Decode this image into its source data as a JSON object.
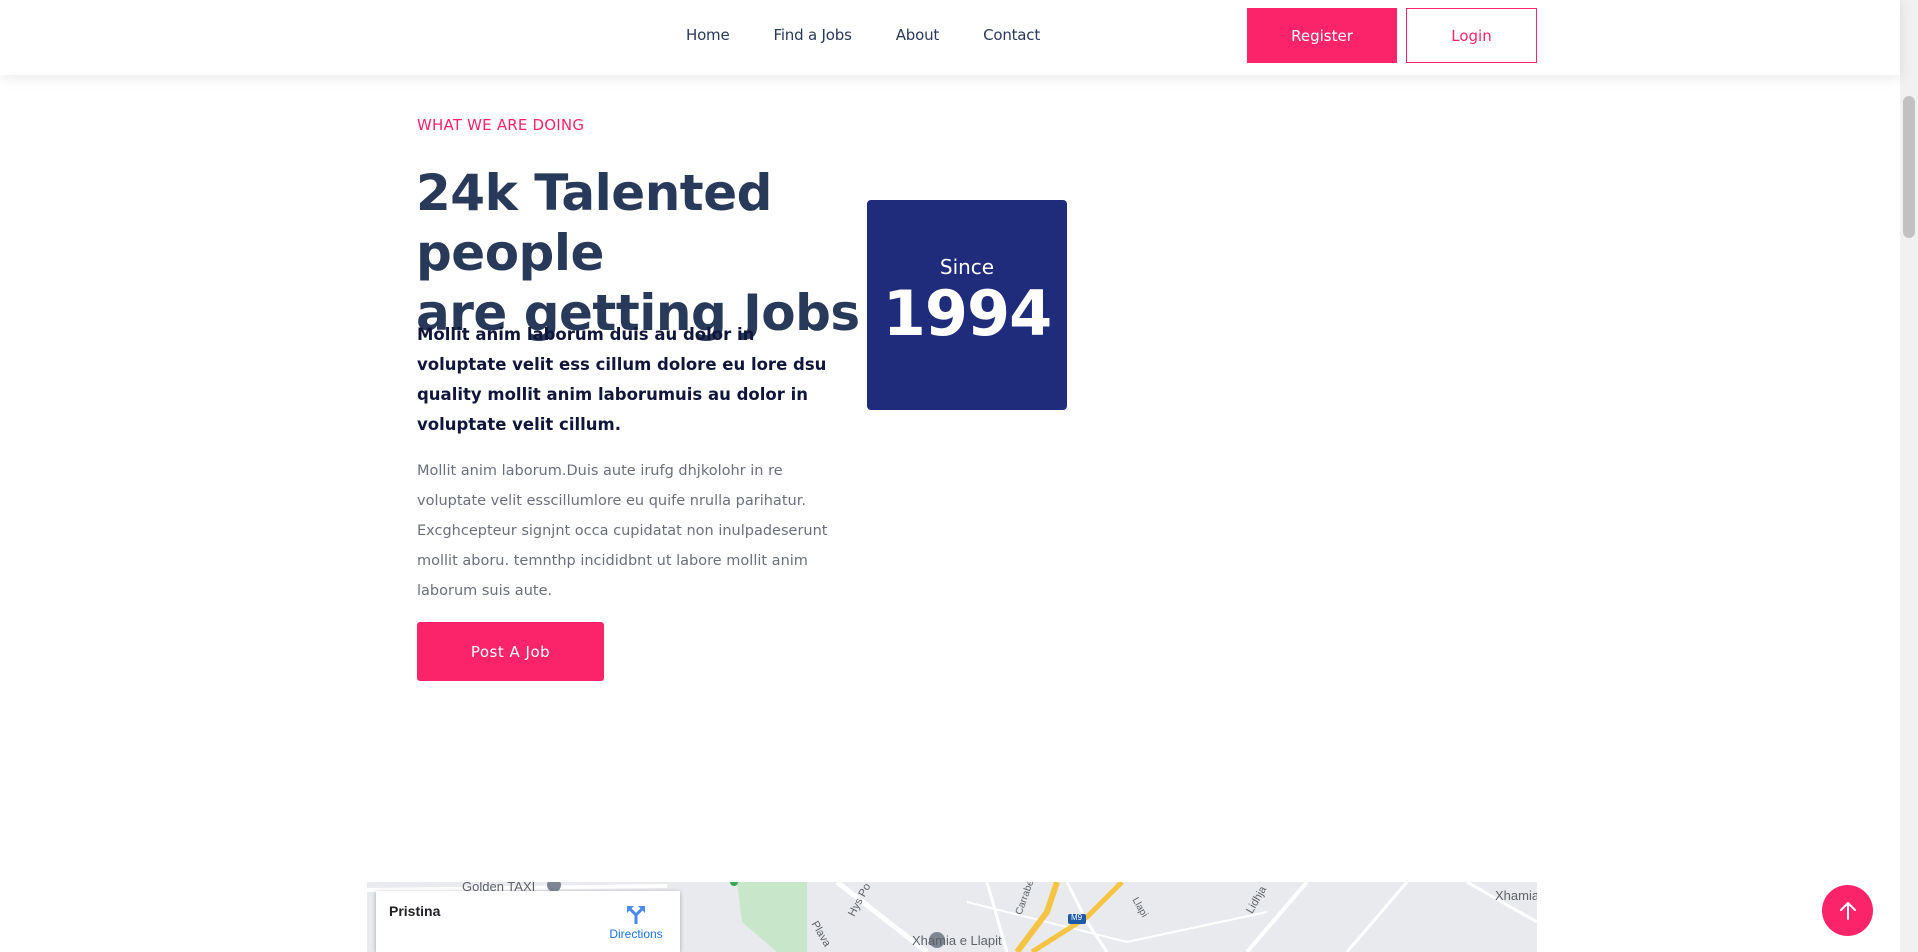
{
  "header": {
    "nav": [
      "Home",
      "Find a Jobs",
      "About",
      "Contact"
    ],
    "register_label": "Register",
    "login_label": "Login"
  },
  "about": {
    "eyebrow": "WHAT WE ARE DOING",
    "headline_line1": "24k Talented people",
    "headline_line2": "are getting Jobs",
    "lead": "Mollit anim laborum duis au dolor in voluptate velit ess cillum dolore eu lore dsu quality mollit anim laborumuis au dolor in voluptate velit cillum.",
    "body": "Mollit anim laborum.Duis aute irufg dhjkolohr in re voluptate velit esscillumlore eu quife nrulla parihatur. Excghcepteur signjnt occa cupidatat non inulpadeserunt mollit aboru. temnthp incididbnt ut labore mollit anim laborum suis aute.",
    "cta_label": "Post A Job",
    "since_label": "Since",
    "since_year": "1994"
  },
  "map": {
    "place_name": "Pristina",
    "directions_label": "Directions",
    "labels": {
      "golden_taxi": "Golden TAXI",
      "xhamia_llapit": "Xhamia e Llapit",
      "xhamia": "Xhamia",
      "route": "M9",
      "plava": "Plava",
      "hys": "Hys Po",
      "llapi": "Llapi",
      "lidhja": "Lidhja",
      "carrabe": "Carrabe"
    }
  },
  "colors": {
    "accent": "#fb246a",
    "navy_box": "#1f2b7b",
    "heading": "#28395a"
  },
  "icons": {
    "back_to_top": "arrow-up-icon",
    "directions": "directions-icon"
  }
}
